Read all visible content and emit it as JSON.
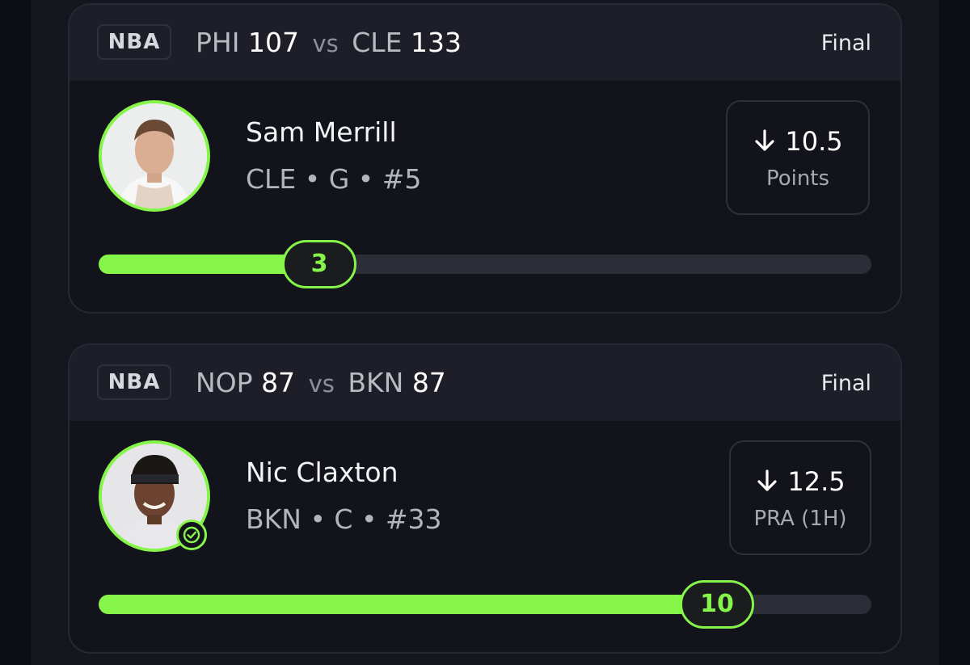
{
  "accent_color": "#86f54a",
  "cards": [
    {
      "league": "NBA",
      "matchup": {
        "team1": "PHI",
        "score1": "107",
        "vs": "vs",
        "team2": "CLE",
        "score2": "133"
      },
      "status": "Final",
      "player": {
        "name": "Sam Merrill",
        "meta": "CLE • G • #5",
        "avatar_icon": "player-headshot",
        "verified": false
      },
      "line": {
        "direction_icon": "arrow-down-icon",
        "value": "10.5",
        "stat": "Points"
      },
      "progress": {
        "value": "3",
        "fraction": 0.286
      }
    },
    {
      "league": "NBA",
      "matchup": {
        "team1": "NOP",
        "score1": "87",
        "vs": "vs",
        "team2": "BKN",
        "score2": "87"
      },
      "status": "Final",
      "player": {
        "name": "Nic Claxton",
        "meta": "BKN • C • #33",
        "avatar_icon": "player-headshot",
        "verified": true
      },
      "line": {
        "direction_icon": "arrow-down-icon",
        "value": "12.5",
        "stat": "PRA (1H)"
      },
      "progress": {
        "value": "10",
        "fraction": 0.8
      }
    }
  ]
}
